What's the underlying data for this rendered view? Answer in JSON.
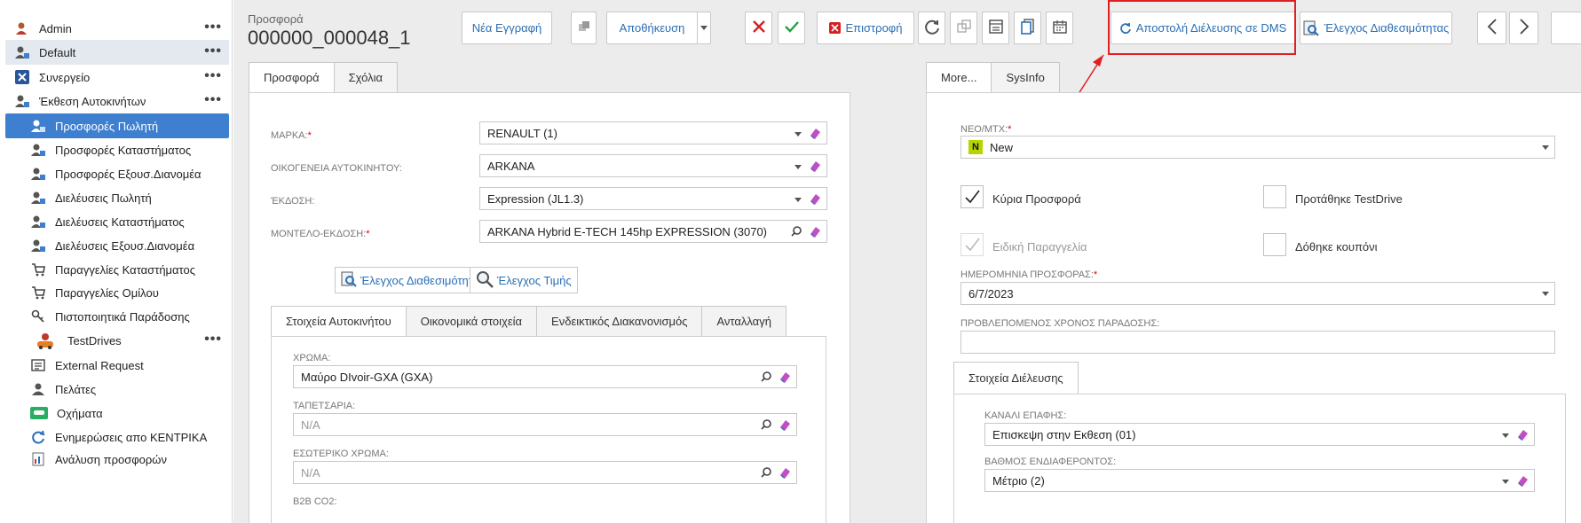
{
  "sidebar": {
    "items": [
      {
        "label": "Admin",
        "icon": "user-admin-icon"
      },
      {
        "label": "Default",
        "icon": "user-gear-icon"
      },
      {
        "label": "Συνεργείο",
        "icon": "tools-icon"
      },
      {
        "label": "Έκθεση Αυτοκινήτων",
        "icon": "user-gear-icon"
      },
      {
        "label": "Προσφορές Πωλητή",
        "icon": "user-gear-icon"
      },
      {
        "label": "Προσφορές Καταστήματος",
        "icon": "user-gear-icon"
      },
      {
        "label": "Προσφορές Εξουσ.Διανομέα",
        "icon": "user-gear-icon"
      },
      {
        "label": "Διελέυσεις Πωλητή",
        "icon": "user-gear-icon"
      },
      {
        "label": "Διελέυσεις Καταστήματος",
        "icon": "user-gear-icon"
      },
      {
        "label": "Διελέυσεις Εξουσ.Διανομέα",
        "icon": "user-gear-icon"
      },
      {
        "label": "Παραγγελίες Καταστήματος",
        "icon": "cart-icon"
      },
      {
        "label": "Παραγγελίες Ομίλου",
        "icon": "cart-icon"
      },
      {
        "label": "Πιστοποιητικά Παράδοσης",
        "icon": "key-user-icon"
      },
      {
        "label": "TestDrives",
        "icon": "car-test-icon"
      },
      {
        "label": "External Request",
        "icon": "list-icon"
      },
      {
        "label": "Πελάτες",
        "icon": "person-icon"
      },
      {
        "label": "Οχήματα",
        "icon": "car-icon"
      },
      {
        "label": "Ενημερώσεις απο ΚΕΝΤΡΙΚΑ",
        "icon": "refresh-icon"
      },
      {
        "label": "Ανάλυση προσφορών",
        "icon": "report-icon"
      }
    ],
    "more": "•••"
  },
  "header": {
    "record_type": "Προσφορά",
    "record_number": "000000_000048_1"
  },
  "toolbar": {
    "new_record": "Νέα Εγγραφή",
    "save": "Αποθήκευση",
    "return": "Επιστροφή",
    "send_dms": "Αποστολή Διέλευσης σε DMS",
    "check_availability": "Έλεγχος Διαθεσιμότητας"
  },
  "left_panel": {
    "tabs": [
      "Προσφορά",
      "Σχόλια"
    ],
    "fields": [
      {
        "label": "ΜΑΡΚΑ:",
        "required": true,
        "value": "RENAULT (1)"
      },
      {
        "label": "ΟΙΚΟΓΕΝΕΙΑ ΑΥΤΟΚΙΝΗΤΟΥ:",
        "required": false,
        "value": "ARKANA"
      },
      {
        "label": "ΈΚΔΟΣΗ:",
        "required": false,
        "value": "Expression (JL1.3)"
      },
      {
        "label": "ΜΟΝΤΕΛΟ-ΕΚΔΟΣΗ:",
        "required": true,
        "value": "ARKANA Hybrid E-TECH 145hp EXPRESSION (3070)"
      }
    ],
    "availability_button": "Έλεγχος Διαθεσιμότητας",
    "price_button": "Έλεγχος Τιμής",
    "sub_tabs": [
      "Στοιχεία Αυτοκινήτου",
      "Οικονομικά στοιχεία",
      "Ενδεικτικός Διακανονισμός",
      "Ανταλλαγή"
    ],
    "car_fields": [
      {
        "label": "ΧΡΩΜΑ:",
        "value": "Μαύρο  DIvoir-GXA (GXA)"
      },
      {
        "label": "ΤΑΠΕΤΣΑΡΙΑ:",
        "value": "N/A"
      },
      {
        "label": "ΕΣΩΤΕΡΙΚΟ ΧΡΩΜΑ:",
        "value": "N/A"
      },
      {
        "label": "B2B CO2:",
        "value": ""
      }
    ]
  },
  "right_panel": {
    "tabs": [
      "More...",
      "SysInfo"
    ],
    "neo_label": "ΝΕΟ/ΜΤΧ:",
    "neo_value": "New",
    "neo_badge": "N",
    "checkboxes": [
      {
        "label": "Κύρια Προσφορά",
        "checked": true,
        "disabled": false
      },
      {
        "label": "Προτάθηκε TestDrive",
        "checked": false,
        "disabled": false
      },
      {
        "label": "Ειδική Παραγγελία",
        "checked": true,
        "disabled": true
      },
      {
        "label": "Δόθηκε κουπόνι",
        "checked": false,
        "disabled": false
      }
    ],
    "date_label": "ΗΜΕΡΟΜΗΝΙΑ ΠΡΟΣΦΟΡΑΣ:",
    "date_value": "6/7/2023",
    "delivery_label": "ΠΡΟΒΛΕΠΟΜΕΝΟΣ ΧΡΟΝΟΣ ΠΑΡΑΔΟΣΗΣ:",
    "delivery_value": "",
    "sub_tab": "Στοιχεία Διέλευσης",
    "channel_label": "ΚΑΝΑΛΙ ΕΠΑΦΗΣ:",
    "channel_value": "Επισκεψη στην Εκθεση (01)",
    "interest_label": "ΒΑΘΜΟΣ ΕΝΔΙΑΦΕΡΟΝΤΟΣ:",
    "interest_value": "Μέτριο (2)"
  },
  "colors": {
    "accent": "#3f7fcf",
    "highlight": "#e02020",
    "link": "#2a6fb5"
  }
}
